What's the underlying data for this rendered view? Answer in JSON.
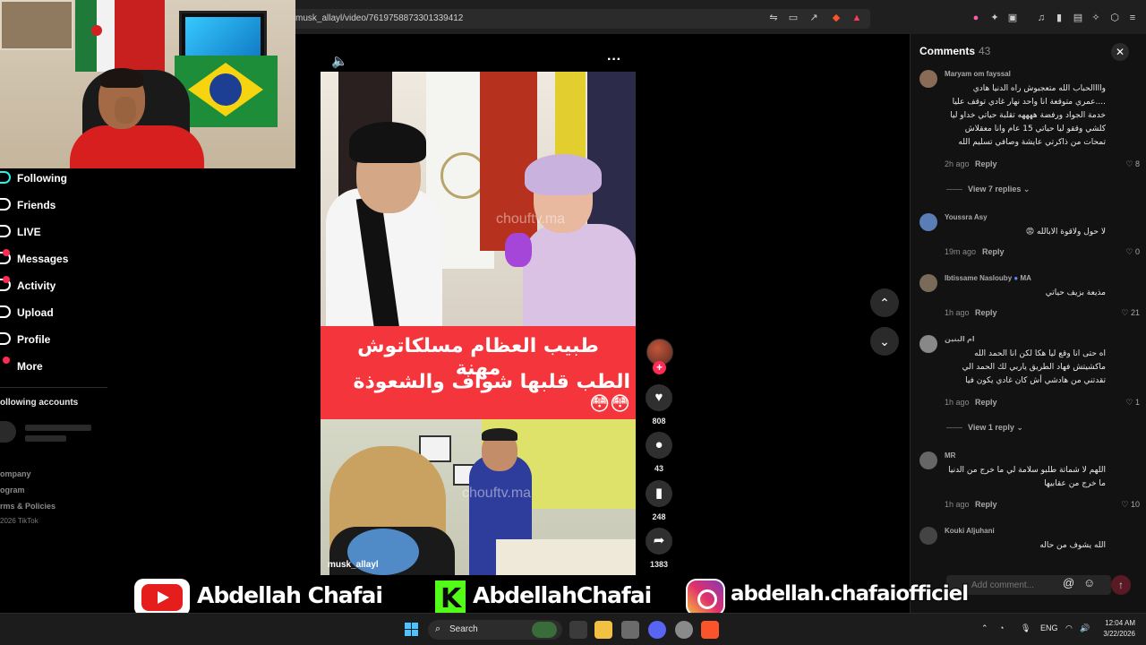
{
  "browser": {
    "url": "musk_allayl/video/7619758873301339412"
  },
  "sidebar": {
    "items": [
      {
        "label": "Following",
        "icon": "following-icon"
      },
      {
        "label": "Friends",
        "icon": "friends-icon"
      },
      {
        "label": "LIVE",
        "icon": "live-icon"
      },
      {
        "label": "Messages",
        "icon": "messages-icon"
      },
      {
        "label": "Activity",
        "icon": "activity-icon"
      },
      {
        "label": "Upload",
        "icon": "upload-icon"
      },
      {
        "label": "Profile",
        "icon": "profile-icon"
      },
      {
        "label": "More",
        "icon": "more-icon"
      }
    ],
    "following_accounts": "ollowing accounts",
    "footer": [
      "ompany",
      "ogram",
      "rms & Policies"
    ],
    "copyright": "2026 TikTok"
  },
  "video": {
    "caption_line1": "طبيب العظام مسلكاتوش مهنة",
    "caption_line2": "الطب قلبها شواف والشعوذة 😳😳",
    "watermark_top": "chouftv.ma",
    "watermark_bottom": "chouftv.ma",
    "author": "musk_allayl"
  },
  "actions": {
    "likes": "808",
    "comments": "43",
    "saves": "248",
    "shares": "1383"
  },
  "comments": {
    "title": "Comments",
    "count": "43",
    "input_placeholder": "Add comment...",
    "list": [
      {
        "user": "Maryam om fayssal",
        "text": "واااالحباب الله متعجبوش راه الدنيا هادي ....عمري متوقعة انا واحد نهار غادي توقف عليا خدمة الجواد ورفضة ههههه تقلبة حياتي خداو ليا كلشي وققو ليا حياتي 15 عام وانا معقلاش تمحات من ذاكرتي عايشة وصافي تسليم الله",
        "time": "2h ago",
        "reply": "Reply",
        "likes": "8",
        "view_replies": "View 7 replies"
      },
      {
        "user": "Youssra Asy",
        "text": "لا حول ولاقوة الابالله 😡",
        "time": "19m ago",
        "reply": "Reply",
        "likes": "0"
      },
      {
        "user": "Ibtissame Naslouby",
        "user_suffix": "MA",
        "text": "مذيعة بزيف حياتي",
        "time": "1h ago",
        "reply": "Reply",
        "likes": "21"
      },
      {
        "user": "ام البنين",
        "text": "اه حتى انا وقع ليا هكا لكن انا الحمد الله ماكشيتش فهاد الطريق ياربي لك الحمد الي تقدتني من هادشي أش كان غادي يكون فيا",
        "time": "1h ago",
        "reply": "Reply",
        "likes": "1",
        "view_replies": "View 1 reply"
      },
      {
        "user": "MR",
        "text": "اللهم لا شماتة طلبو سلامة لي ما خرج من الدنيا ما خرج من عقابيها",
        "time": "1h ago",
        "reply": "Reply",
        "likes": "10"
      },
      {
        "user": "Kouki Aljuhani",
        "text": "الله يشوف من حاله"
      }
    ]
  },
  "overlay": {
    "youtube": "Abdellah Chafai",
    "kick": "AbdellahChafai",
    "instagram": "abdellah.chafaiofficiel"
  },
  "taskbar": {
    "search_label": "Search",
    "lang": "ENG",
    "time": "12:04 AM",
    "date": "3/22/2026"
  },
  "colors": {
    "accent": "#fe2c55",
    "caption_bg": "#f4353b",
    "panel_bg": "#121212"
  }
}
